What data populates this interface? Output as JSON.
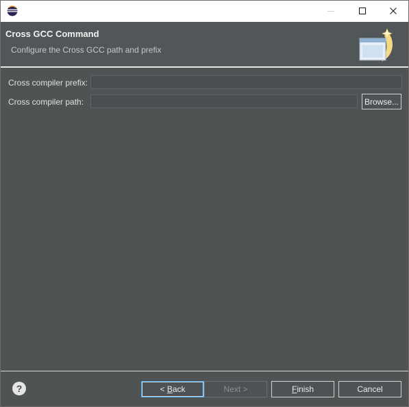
{
  "window": {
    "controls": {
      "minimize": "minimize-icon",
      "maximize": "maximize-icon",
      "close": "close-icon"
    }
  },
  "header": {
    "title": "Cross GCC Command",
    "description": "Configure the Cross GCC path and prefix"
  },
  "form": {
    "prefix_label": "Cross compiler prefix:",
    "prefix_value": "",
    "path_label": "Cross compiler path:",
    "path_value": "",
    "browse_label": "Browse..."
  },
  "footer": {
    "help_glyph": "?",
    "back_label_prefix": "< ",
    "back_label_mnemonic": "B",
    "back_label_rest": "ack",
    "next_label": "Next >",
    "finish_label_mnemonic": "F",
    "finish_label_rest": "inish",
    "cancel_label": "Cancel"
  },
  "colors": {
    "dialog_bg": "#505354",
    "accent_focus": "#4aa3e8",
    "text": "#e0e0e0"
  }
}
